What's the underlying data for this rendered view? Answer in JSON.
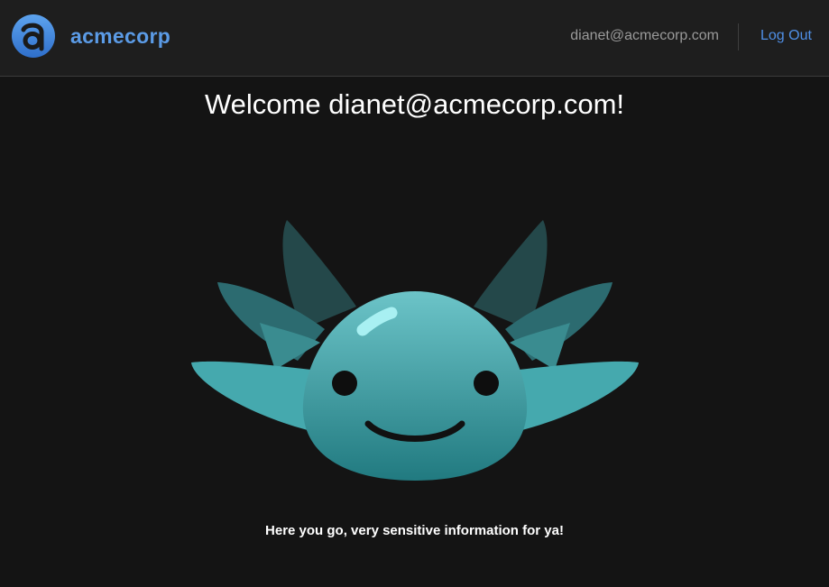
{
  "header": {
    "brand_name": "acmecorp",
    "user_email": "dianet@acmecorp.com",
    "logout_label": "Log Out",
    "brand_color": "#5b9be6",
    "link_color": "#4f8fe6"
  },
  "main": {
    "welcome_text": "Welcome dianet@acmecorp.com!",
    "mascot": "axolotl-mascot",
    "message": "Here you go, very sensitive information for ya!"
  },
  "icons": {
    "logo": "acmecorp-logo-icon"
  }
}
